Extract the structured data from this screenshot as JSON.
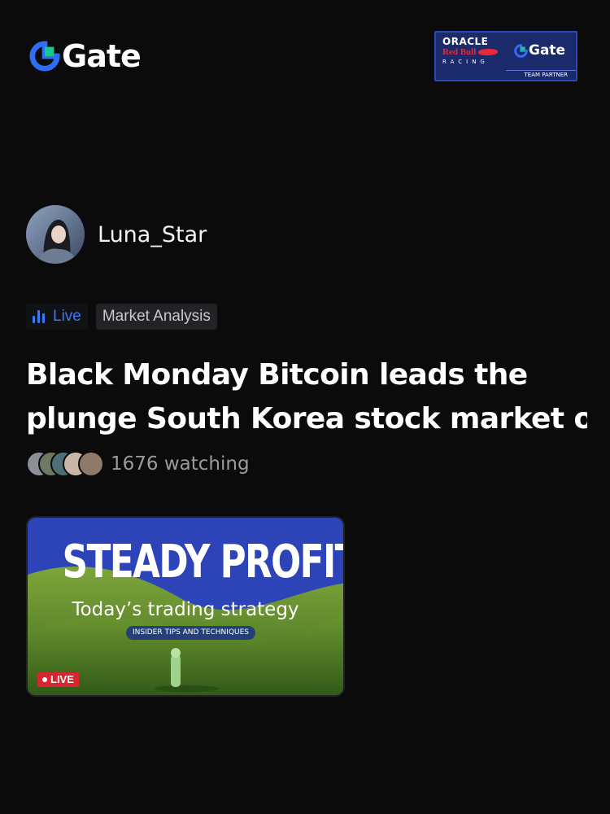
{
  "header": {
    "brand_name": "Gate",
    "partner": {
      "line1": "ORACLE",
      "line2": "Red Bull",
      "line3": "RACING",
      "gate": "Gate",
      "footer": "TEAM PARTNER"
    }
  },
  "author": {
    "name": "Luna_Star"
  },
  "tags": {
    "live": "Live",
    "category": "Market Analysis"
  },
  "post": {
    "title_line1": "Black Monday Bitcoin leads the",
    "title_line2": "plunge South Korea stock market o"
  },
  "audience": {
    "watching": "1676 watching"
  },
  "thumbnail": {
    "headline": "STEADY PROFITS",
    "subtitle": "Today’s trading strategy",
    "pill": "INSIDER TIPS AND TECHNIQUES",
    "live_badge": "LIVE"
  },
  "colors": {
    "background": "#0b0b0c",
    "brand_blue": "#2f6df6",
    "brand_green": "#19c78a",
    "live_blue": "#3a7bf0",
    "live_red": "#d7262f"
  }
}
